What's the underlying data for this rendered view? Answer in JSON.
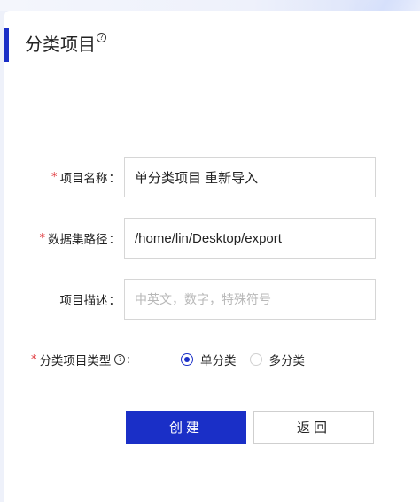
{
  "page": {
    "title": "分类项目",
    "help_icon": "?"
  },
  "form": {
    "project_name": {
      "required_mark": "*",
      "label": "项目名称",
      "colon": "：",
      "value": "单分类项目 重新导入"
    },
    "dataset_path": {
      "required_mark": "*",
      "label": "数据集路径",
      "colon": "：",
      "value": "/home/lin/Desktop/export"
    },
    "description": {
      "label": "项目描述",
      "colon": "：",
      "placeholder": "中英文，数字，特殊符号"
    },
    "project_type": {
      "required_mark": "*",
      "label": "分类项目类型",
      "help_icon": "?",
      "colon": ":",
      "options": [
        {
          "label": "单分类",
          "selected": true
        },
        {
          "label": "多分类",
          "selected": false
        }
      ]
    }
  },
  "buttons": {
    "create": "创建",
    "back": "返回"
  },
  "colors": {
    "accent": "#1a2fc7",
    "required": "#e0363b"
  }
}
